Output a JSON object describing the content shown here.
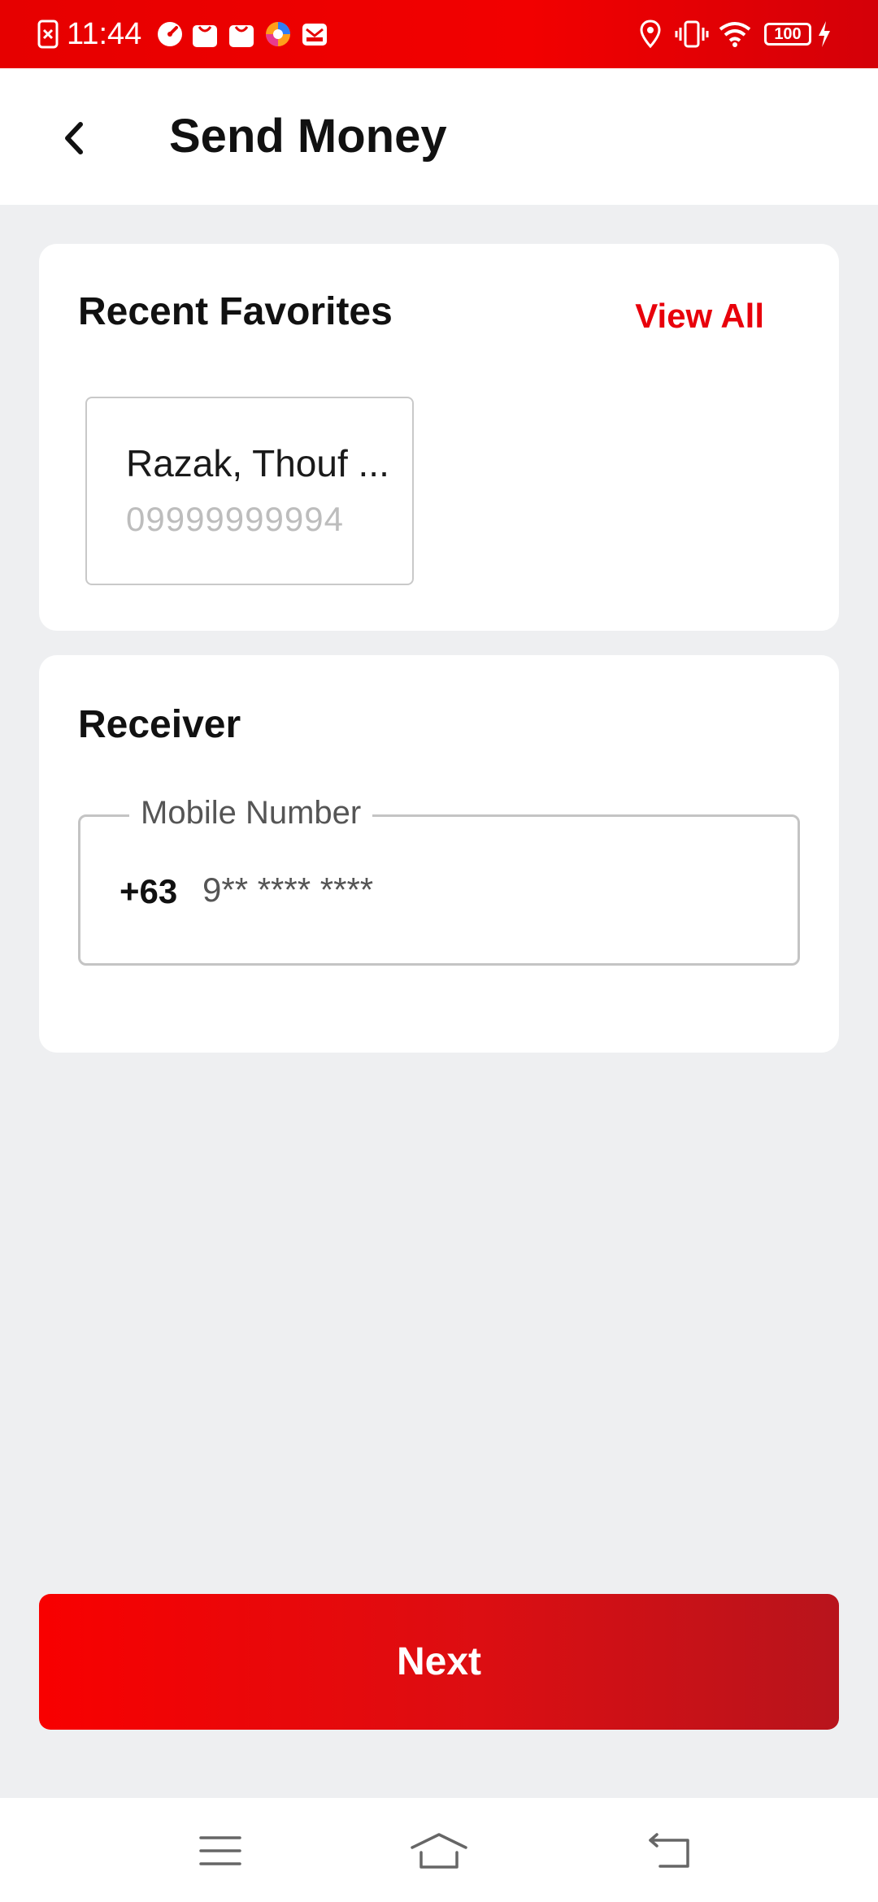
{
  "status_bar": {
    "time": "11:44",
    "battery": "100",
    "icons": [
      "screenshot-icon",
      "speedometer-icon",
      "shopping-bag-icon",
      "shopping-bag-icon",
      "browser-icon",
      "mail-icon",
      "location-icon",
      "vibrate-icon",
      "wifi-icon",
      "battery-icon",
      "charging-icon"
    ]
  },
  "app_bar": {
    "title": "Send Money",
    "back_icon": "chevron-left-icon"
  },
  "favorites": {
    "title": "Recent Favorites",
    "view_all_label": "View All",
    "items": [
      {
        "name": "Razak, Thouf ...",
        "number": "09999999994"
      }
    ]
  },
  "receiver": {
    "title": "Receiver",
    "field_label": "Mobile Number",
    "country_code": "+63",
    "placeholder": "9** **** ****",
    "value": ""
  },
  "actions": {
    "next_label": "Next"
  },
  "nav_bar": {
    "icons": [
      "menu-icon",
      "home-icon",
      "back-icon"
    ]
  },
  "colors": {
    "brand_red": "#e8000b",
    "background": "#eeeff1",
    "placeholder_gray": "#bdbdbd"
  }
}
